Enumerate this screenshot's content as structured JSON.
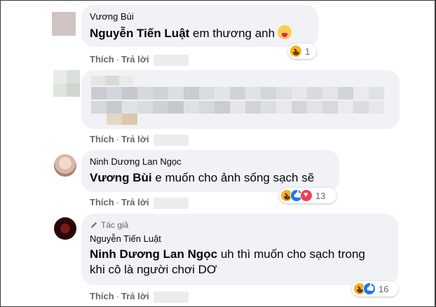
{
  "comments": [
    {
      "author": "Vương Bùi",
      "mention": "Nguyễn Tiến Luật",
      "text": " em thương anh",
      "reaction_count": "1",
      "like_label": "Thích",
      "reply_label": "Trả lời"
    },
    {
      "like_label": "Thích",
      "reply_label": "Trả lời"
    },
    {
      "author": "Ninh Dương Lan Ngọc",
      "mention": "Vương Bùi",
      "text": " e muốn cho ảnh sống sạch sẽ",
      "reaction_count": "13",
      "like_label": "Thích",
      "reply_label": "Trả lời"
    },
    {
      "author_badge": "Tác giả",
      "author": "Nguyễn Tiến Luật",
      "mention": "Ninh Dương Lan Ngọc",
      "text_line1": " uh thì muốn cho sạch trong",
      "text_line2": "khi cô là người chơi DƠ",
      "reaction_count": "16",
      "like_label": "Thích",
      "reply_label": "Trả lời"
    }
  ],
  "icons": {
    "haha": "haha-reaction-icon",
    "like": "like-reaction-icon",
    "love": "love-reaction-icon",
    "pencil": "pencil-icon"
  },
  "colors": {
    "bubble": "#f0f2f5",
    "meta_text": "#65676b",
    "like_blue": "#1877f2",
    "love_red": "#f33e58",
    "haha_yellow": "#f7b125"
  }
}
